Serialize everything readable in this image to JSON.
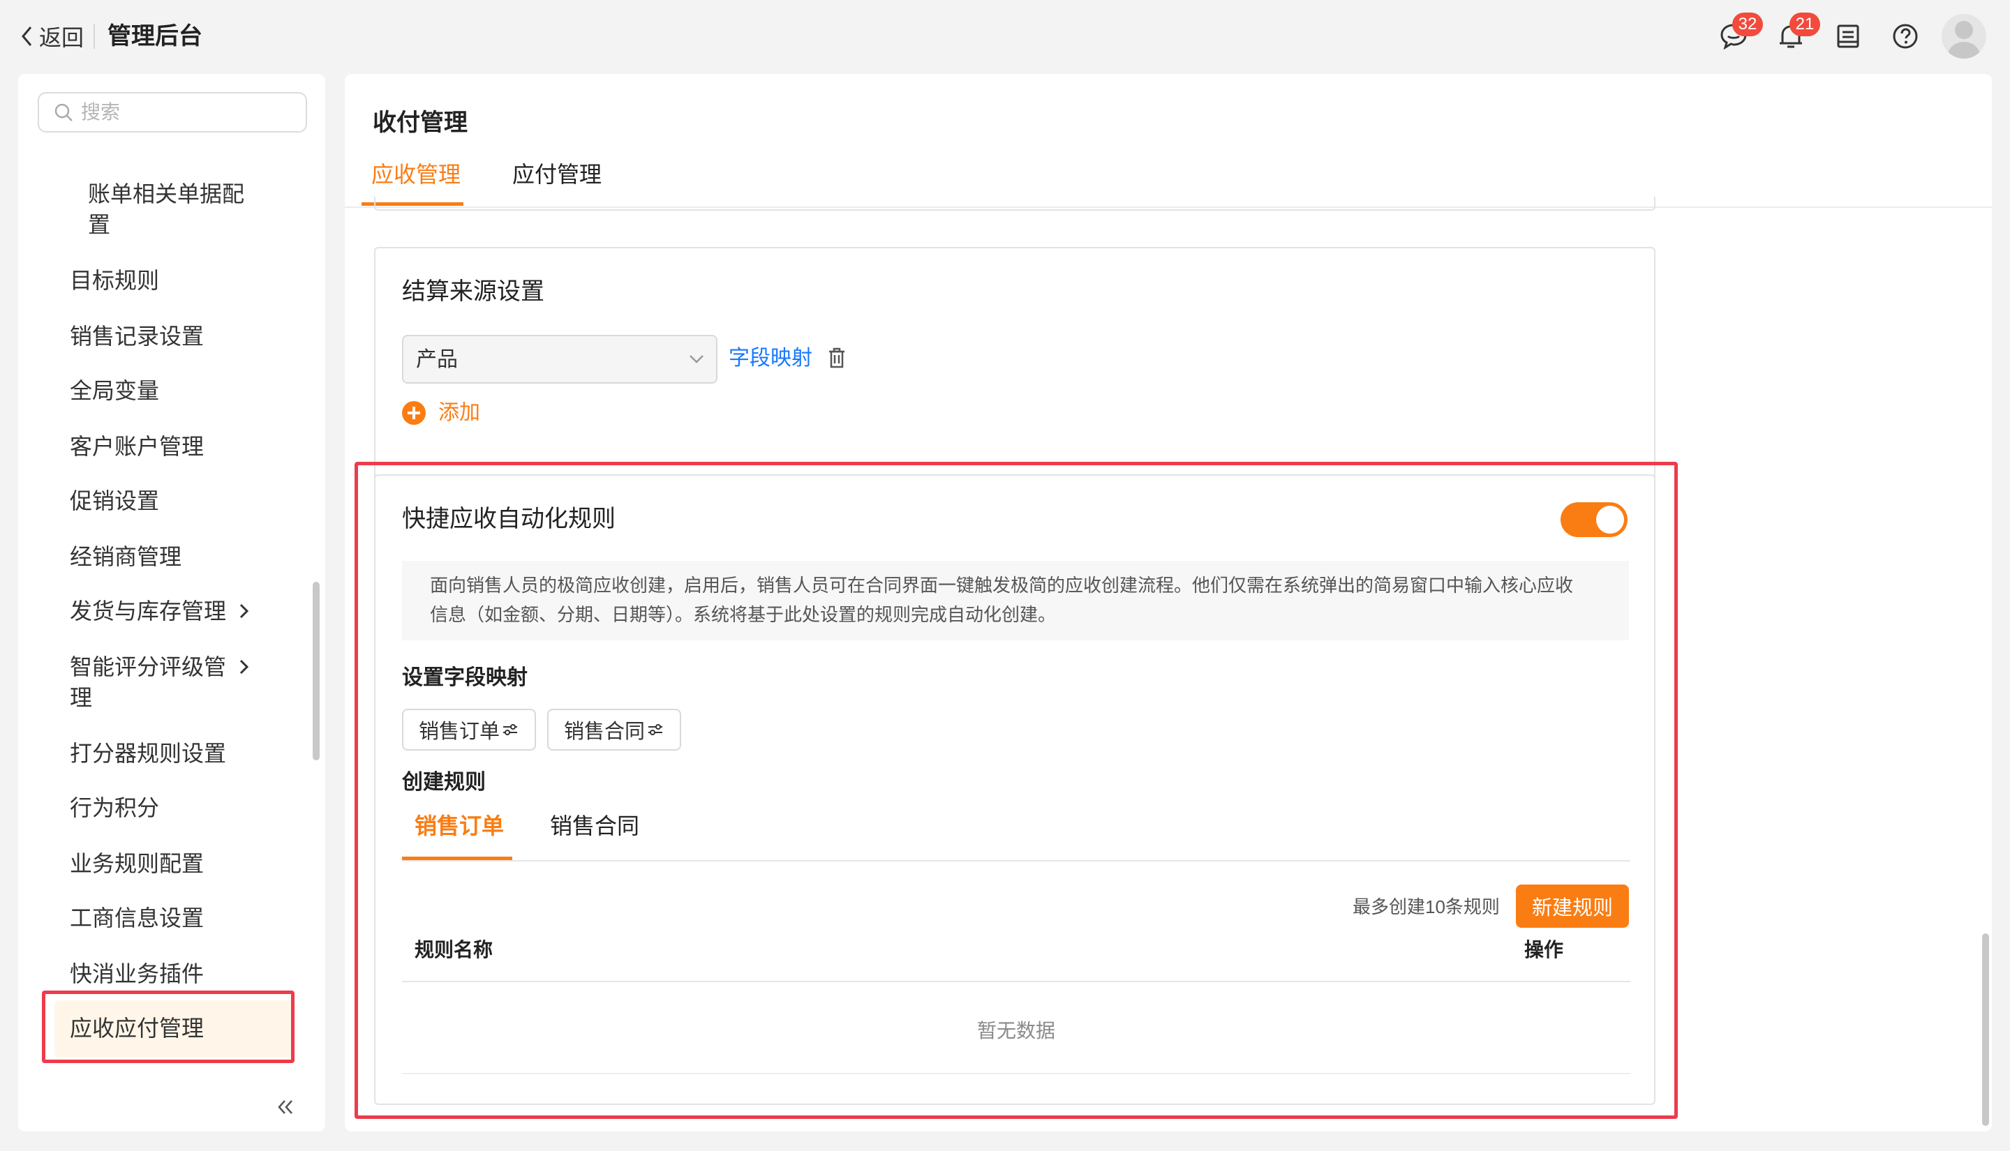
{
  "header": {
    "back_label": "返回",
    "app_title": "管理后台",
    "message_badge": "32",
    "notification_badge": "21"
  },
  "sidebar": {
    "search_placeholder": "搜索",
    "items": [
      {
        "label_line1": "账单相关单据配",
        "label_line2": "置"
      },
      {
        "label": "目标规则"
      },
      {
        "label": "销售记录设置"
      },
      {
        "label": "全局变量"
      },
      {
        "label": "客户账户管理"
      },
      {
        "label": "促销设置"
      },
      {
        "label": "经销商管理"
      },
      {
        "label": "发货与库存管理",
        "has_submenu": true
      },
      {
        "label_line1": "智能评分评级管",
        "label_line2": "理",
        "has_submenu": true
      },
      {
        "label": "打分器规则设置"
      },
      {
        "label": "行为积分"
      },
      {
        "label": "业务规则配置"
      },
      {
        "label": "工商信息设置"
      },
      {
        "label": "快消业务插件"
      },
      {
        "label": "应收应付管理",
        "active": true
      }
    ]
  },
  "main": {
    "title": "收付管理",
    "tabs": [
      {
        "label": "应收管理",
        "active": true
      },
      {
        "label": "应付管理",
        "active": false
      }
    ],
    "settlement": {
      "title": "结算来源设置",
      "select_value": "产品",
      "field_mapping_link": "字段映射",
      "add_label": "添加"
    },
    "quick_rule": {
      "title": "快捷应收自动化规则",
      "enabled": true,
      "desc_line1": "面向销售人员的极简应收创建，启用后，销售人员可在合同界面一键触发极简的应收创建流程。他们仅需在系统弹出的简易窗口中输入核心应收",
      "desc_line2": "信息（如金额、分期、日期等）。系统将基于此处设置的规则完成自动化创建。",
      "mapping_label": "设置字段映射",
      "mapping_chips": [
        "销售订单",
        "销售合同"
      ],
      "create_rule_label": "创建规则",
      "subtabs": [
        {
          "label": "销售订单",
          "active": true
        },
        {
          "label": "销售合同",
          "active": false
        }
      ],
      "limit_text": "最多创建10条规则",
      "new_rule_button": "新建规则",
      "table_headers": {
        "name": "规则名称",
        "action": "操作"
      },
      "empty_text": "暂无数据"
    }
  },
  "colors": {
    "accent": "#fa7d14",
    "link": "#1677ff",
    "highlight": "#ec3c4c",
    "badge": "#f24a3d"
  },
  "icons": [
    "chevron-left-icon",
    "chat-icon",
    "bell-icon",
    "document-icon",
    "help-icon",
    "avatar",
    "search-icon",
    "chevron-right-icon",
    "double-chevron-left-icon",
    "chevron-down-icon",
    "trash-icon",
    "plus-circle-icon",
    "settings-sliders-icon"
  ]
}
